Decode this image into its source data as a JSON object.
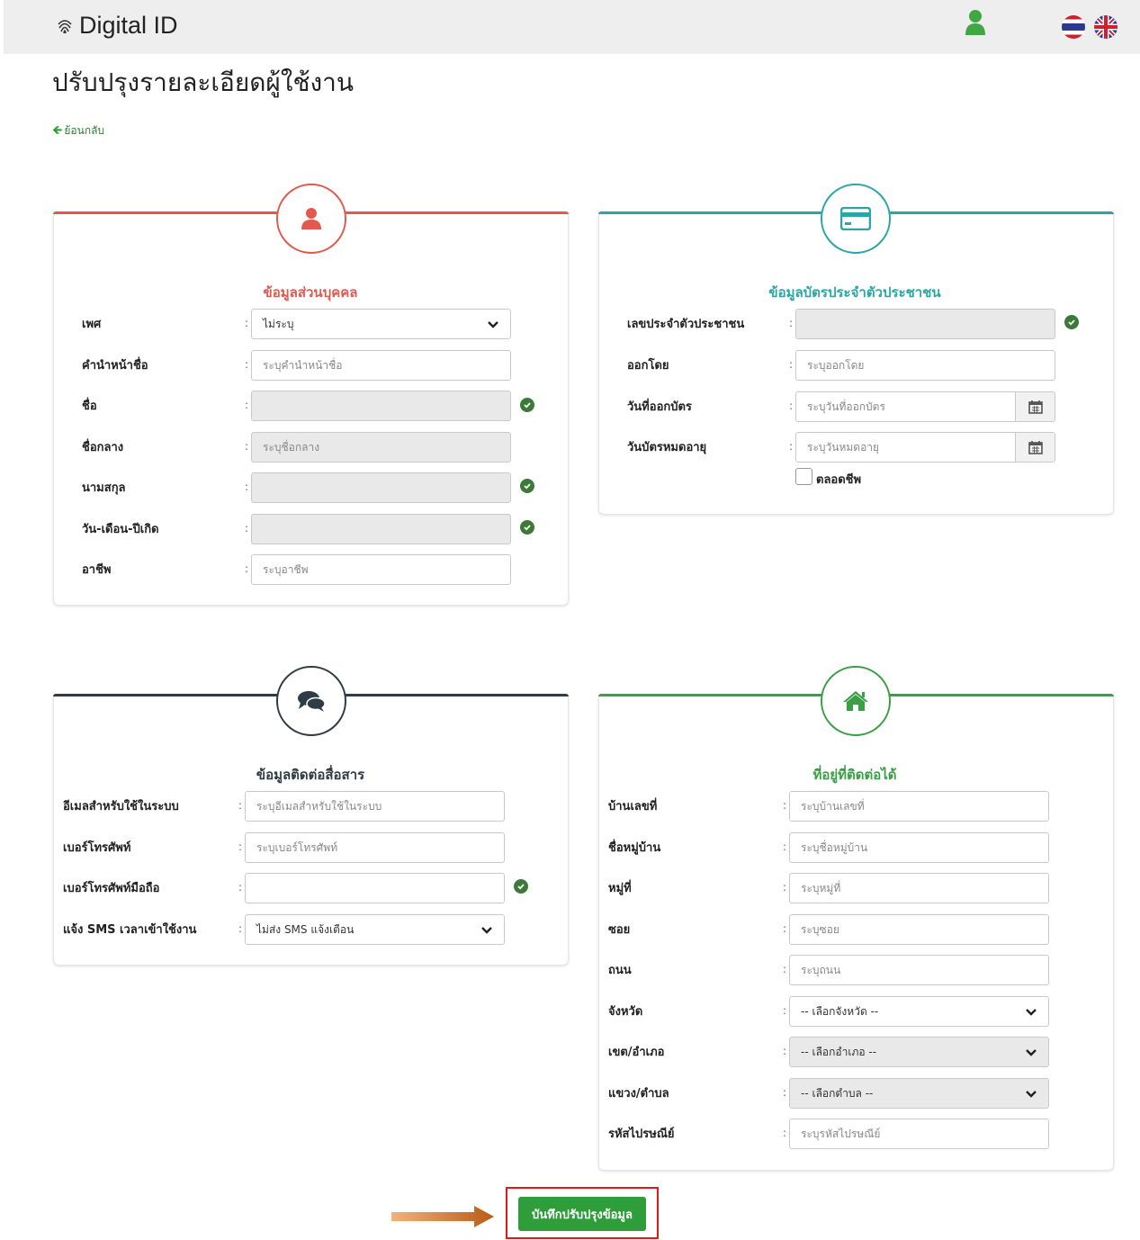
{
  "app": {
    "brand": "Digital ID",
    "icons": {
      "logo": "fingerprint-icon",
      "user": "user-icon",
      "lang_th": "thai-flag-icon",
      "lang_en": "uk-flag-icon"
    }
  },
  "page": {
    "title": "ปรับปรุงรายละเอียดผู้ใช้งาน",
    "back_label": "ย้อนกลับ"
  },
  "personal": {
    "title": "ข้อมูลส่วนบุคคล",
    "color": "#e05a50",
    "fields": {
      "gender": {
        "label": "เพศ",
        "value": "ไม่ระบุ"
      },
      "prefix": {
        "label": "คำนำหน้าชื่อ",
        "placeholder": "ระบุคำนำหน้าชื่อ"
      },
      "first_name": {
        "label": "ชื่อ",
        "value": ""
      },
      "middle_name": {
        "label": "ชื่อกลาง",
        "placeholder": "ระบุชื่อกลาง"
      },
      "last_name": {
        "label": "นามสกุล",
        "value": ""
      },
      "birthdate": {
        "label": "วัน-เดือน-ปีเกิด",
        "value": ""
      },
      "occupation": {
        "label": "อาชีพ",
        "placeholder": "ระบุอาชีพ"
      }
    }
  },
  "idcard": {
    "title": "ข้อมูลบัตรประจำตัวประชาชน",
    "color": "#2ba6a6",
    "fields": {
      "id_number": {
        "label": "เลขประจำตัวประชาชน",
        "value": ""
      },
      "issued_by": {
        "label": "ออกโดย",
        "placeholder": "ระบุออกโดย"
      },
      "issue_date": {
        "label": "วันที่ออกบัตร",
        "placeholder": "ระบุวันที่ออกบัตร"
      },
      "expiry_date": {
        "label": "วันบัตรหมดอายุ",
        "placeholder": "ระบุวันหมดอายุ"
      },
      "lifetime": {
        "label": "ตลอดชีพ",
        "checked": false
      }
    }
  },
  "contact": {
    "title": "ข้อมูลติดต่อสื่อสาร",
    "color": "#2f3b45",
    "fields": {
      "email": {
        "label": "อีเมลสำหรับใช้ในระบบ",
        "placeholder": "ระบุอีเมลสำหรับใช้ในระบบ"
      },
      "phone": {
        "label": "เบอร์โทรศัพท์",
        "placeholder": "ระบุเบอร์โทรศัพท์"
      },
      "mobile": {
        "label": "เบอร์โทรศัพท์มือถือ",
        "value": ""
      },
      "sms": {
        "label": "แจ้ง SMS เวลาเข้าใช้งาน",
        "value": "ไม่ส่ง SMS แจ้งเตือน"
      }
    }
  },
  "address": {
    "title": "ที่อยู่ที่ติดต่อได้",
    "color": "#3aa047",
    "fields": {
      "house_no": {
        "label": "บ้านเลขที่",
        "placeholder": "ระบุบ้านเลขที่"
      },
      "village": {
        "label": "ชื่อหมู่บ้าน",
        "placeholder": "ระบุชื่อหมู่บ้าน"
      },
      "moo": {
        "label": "หมู่ที่",
        "placeholder": "ระบุหมู่ที่"
      },
      "soi": {
        "label": "ซอย",
        "placeholder": "ระบุซอย"
      },
      "road": {
        "label": "ถนน",
        "placeholder": "ระบุถนน"
      },
      "province": {
        "label": "จังหวัด",
        "value": "-- เลือกจังหวัด --"
      },
      "district": {
        "label": "เขต/อำเภอ",
        "value": "-- เลือกอำเภอ --"
      },
      "subdistrict": {
        "label": "แขวง/ตำบล",
        "value": "-- เลือกตำบล --"
      },
      "postcode": {
        "label": "รหัสไปรษณีย์",
        "placeholder": "ระบุรหัสไปรษณีย์"
      }
    }
  },
  "actions": {
    "save_label": "บันทึกปรับปรุงข้อมูล",
    "accent": "#2e9d3a",
    "highlight": "#e01818"
  }
}
